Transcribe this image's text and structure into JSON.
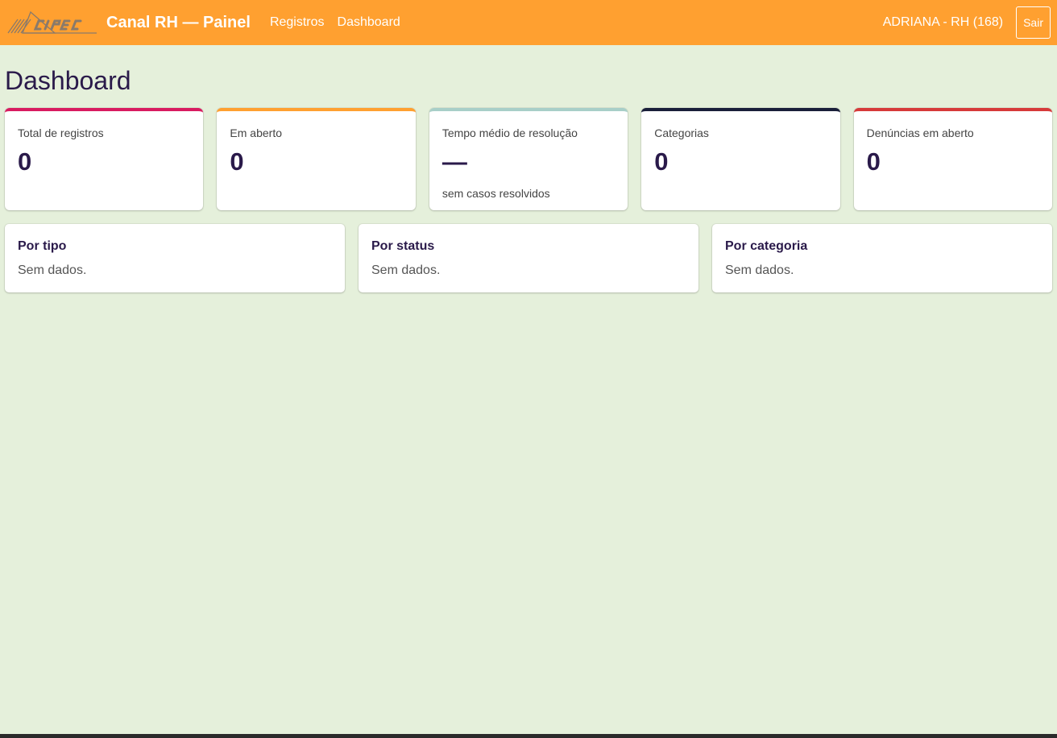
{
  "navbar": {
    "logo_icon": "cipec-logo-icon",
    "brand": "Canal RH — Painel",
    "links": [
      {
        "label": "Registros"
      },
      {
        "label": "Dashboard"
      }
    ],
    "user": "ADRIANA - RH (168)",
    "logout_label": "Sair"
  },
  "page": {
    "title": "Dashboard"
  },
  "stats": [
    {
      "label": "Total de registros",
      "value": "0",
      "sub": "",
      "accent": "#d81b60"
    },
    {
      "label": "Em aberto",
      "value": "0",
      "sub": "",
      "accent": "#ffa030"
    },
    {
      "label": "Tempo médio de resolução",
      "value": "—",
      "sub": "sem casos resolvidos",
      "accent": "#a8cfc8"
    },
    {
      "label": "Categorias",
      "value": "0",
      "sub": "",
      "accent": "#1a1f3a"
    },
    {
      "label": "Denúncias em aberto",
      "value": "0",
      "sub": "",
      "accent": "#d63a3a"
    }
  ],
  "panels": [
    {
      "title": "Por tipo",
      "empty": "Sem dados."
    },
    {
      "title": "Por status",
      "empty": "Sem dados."
    },
    {
      "title": "Por categoria",
      "empty": "Sem dados."
    }
  ],
  "colors": {
    "navbar": "#ffa030",
    "background": "#e5f0db",
    "text": "#2a1a4a"
  }
}
